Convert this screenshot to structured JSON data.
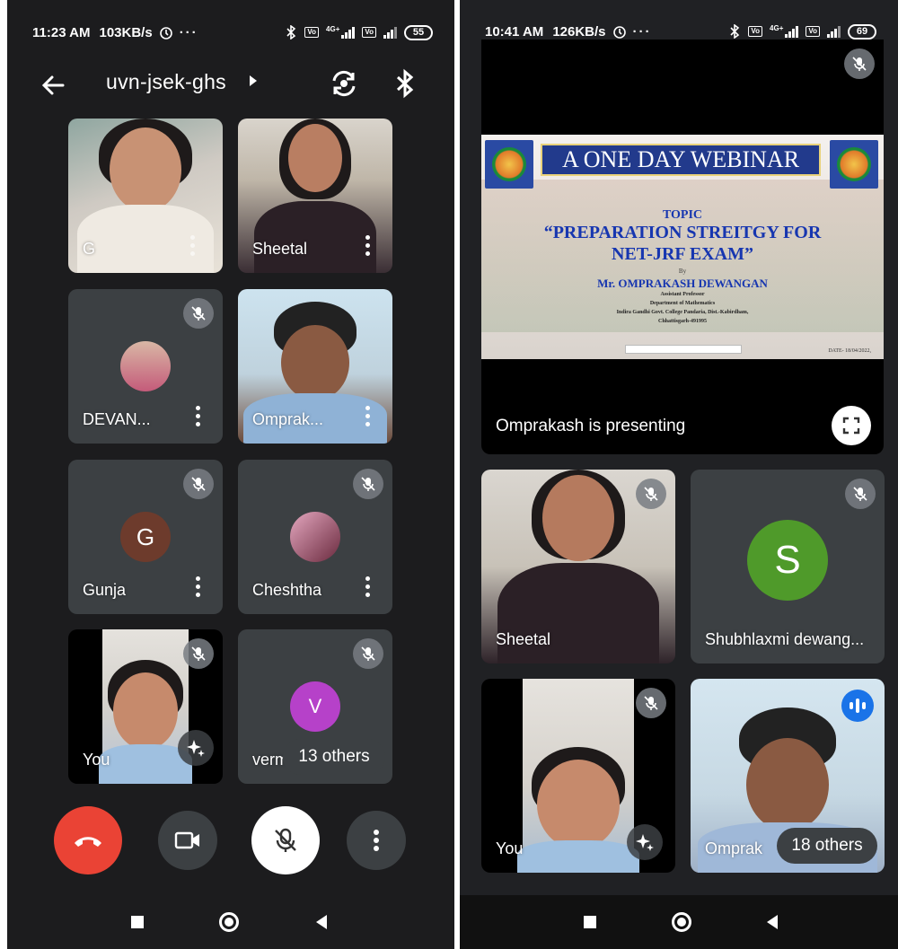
{
  "left": {
    "status": {
      "time": "11:23 AM",
      "speed": "103KB/s",
      "battery": "55",
      "signal_label": "4G+"
    },
    "meeting_code": "uvn-jsek-ghs",
    "tiles": [
      {
        "name": "G"
      },
      {
        "name": "Sheetal"
      },
      {
        "name": "DEVAN..."
      },
      {
        "name": "Omprak..."
      },
      {
        "name": "Gunja",
        "initial": "G"
      },
      {
        "name": "Cheshtha"
      },
      {
        "name": "You"
      },
      {
        "name": "verm",
        "initial": "V"
      }
    ],
    "others_label": "13 others"
  },
  "right": {
    "status": {
      "time": "10:41 AM",
      "speed": "126KB/s",
      "battery": "69",
      "signal_label": "4G+"
    },
    "slide": {
      "banner": "A ONE DAY WEBINAR",
      "topic": "TOPIC",
      "headline1": "“PREPARATION STREITGY FOR",
      "headline2": "NET-JRF EXAM”",
      "by": "By",
      "presenter": "Mr. OMPRAKASH DEWANGAN",
      "line1": "Assistant Professor",
      "line2": "Department of Mathematics",
      "line3": "Indira Gandhi Govt. College Pandaria, Dist.-Kabirdham,",
      "line4": "Chhattisgarh-491995",
      "date": "DATE- 18/04/2022,"
    },
    "presenting_label": "Omprakash is presenting",
    "tiles": [
      {
        "name": "Sheetal"
      },
      {
        "name": "Shubhlaxmi dewang...",
        "initial": "S"
      },
      {
        "name": "You"
      },
      {
        "name": "Omprak"
      }
    ],
    "others_label": "18 others"
  },
  "colors": {
    "end_call": "#ea4335",
    "avatar_gunja": "#6d3b2c",
    "avatar_verm": "#b641c9",
    "avatar_shubh": "#4f9a2a",
    "speaking": "#1a73e8"
  }
}
